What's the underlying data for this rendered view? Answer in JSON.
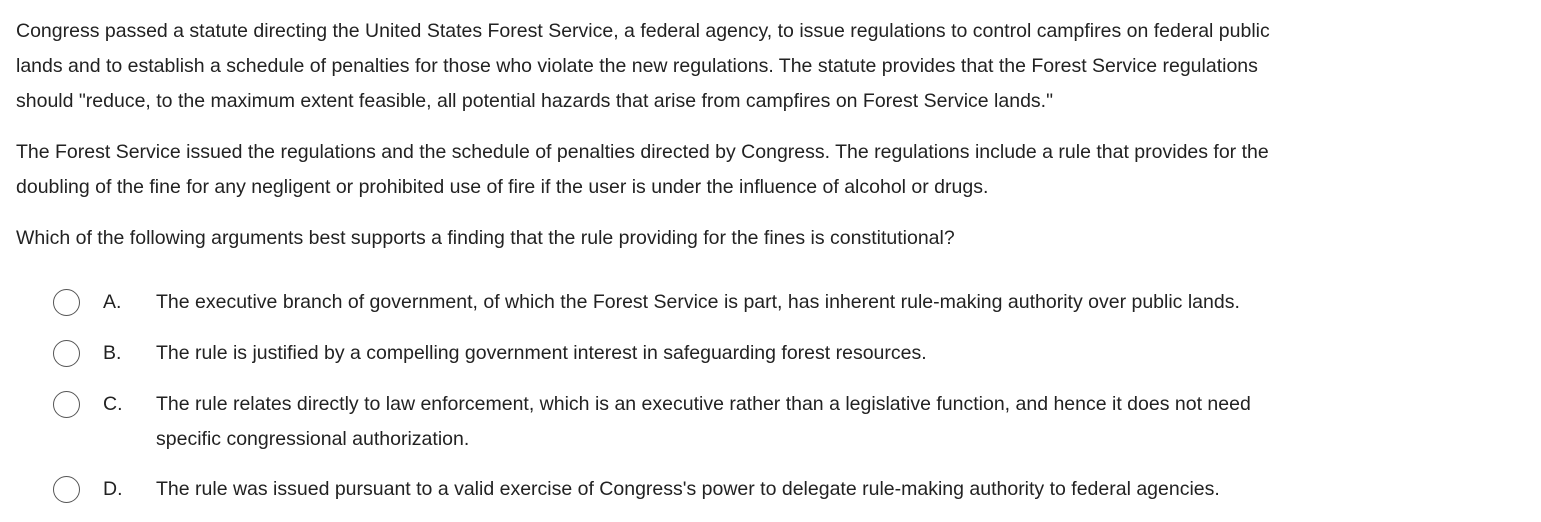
{
  "question": {
    "paragraph1": "Congress passed a statute directing the United States Forest Service, a federal agency, to issue regulations to control campfires on federal public\nlands and to establish a schedule of penalties for those who violate the new regulations.  The statute provides that the Forest Service regulations\nshould \"reduce, to the maximum extent feasible, all potential hazards that arise from campfires on Forest Service lands.\"",
    "paragraph2": "The Forest Service issued the regulations and the schedule of penalties directed by Congress.  The regulations include a rule that provides for the\ndoubling of the fine for any negligent or prohibited use of fire if the user is under the influence of alcohol or drugs.",
    "prompt": "Which of the following arguments best supports a finding that the rule providing for the fines is constitutional?"
  },
  "choices": [
    {
      "letter": "A.",
      "text": "The executive branch of government, of which the Forest Service is part, has inherent rule-making authority over public lands."
    },
    {
      "letter": "B.",
      "text": "The rule is justified by a compelling government interest in safeguarding forest resources."
    },
    {
      "letter": "C.",
      "text": "The rule relates directly to law enforcement, which is an executive rather than a legislative function, and hence it does not need\nspecific congressional authorization."
    },
    {
      "letter": "D.",
      "text": "The rule was issued pursuant to a valid exercise of Congress's power to delegate rule-making authority to federal agencies."
    }
  ]
}
